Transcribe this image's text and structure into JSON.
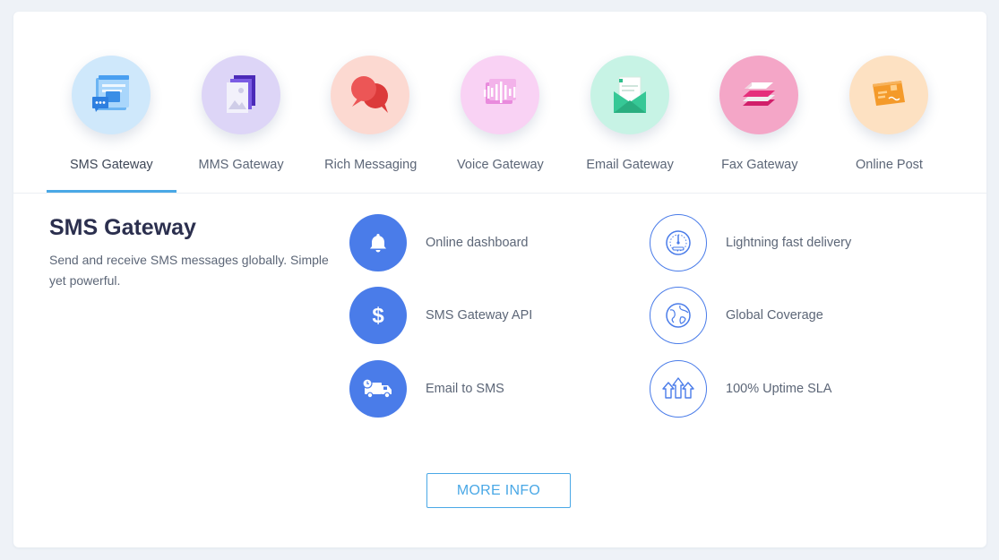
{
  "tabs": [
    {
      "label": "SMS Gateway",
      "icon": "sms-chat-window-icon",
      "color": "#cfe8fb",
      "active": true
    },
    {
      "label": "MMS Gateway",
      "icon": "mms-image-stack-icon",
      "color": "#ddd5f7",
      "active": false
    },
    {
      "label": "Rich Messaging",
      "icon": "chat-bubbles-icon",
      "color": "#fcd9d1",
      "active": false
    },
    {
      "label": "Voice Gateway",
      "icon": "voice-waveform-icon",
      "color": "#f9d2f4",
      "active": false
    },
    {
      "label": "Email Gateway",
      "icon": "email-envelope-icon",
      "color": "#c7f3e5",
      "active": false
    },
    {
      "label": "Fax Gateway",
      "icon": "fax-paper-stack-icon",
      "color": "#f4a6c7",
      "active": false
    },
    {
      "label": "Online Post",
      "icon": "postcard-icon",
      "color": "#fde1c2",
      "active": false
    }
  ],
  "panel": {
    "title": "SMS Gateway",
    "description": "Send and receive SMS messages globally. Simple yet powerful."
  },
  "features": [
    {
      "label": "Online dashboard",
      "icon": "bell-icon"
    },
    {
      "label": "SMS Gateway API",
      "icon": "dollar-icon"
    },
    {
      "label": "Email to SMS",
      "icon": "delivery-truck-icon"
    },
    {
      "label": "Lightning fast delivery",
      "icon": "speedometer-icon"
    },
    {
      "label": "Global Coverage",
      "icon": "globe-icon"
    },
    {
      "label": "100% Uptime SLA",
      "icon": "up-arrows-icon"
    }
  ],
  "more_button": {
    "label": "MORE INFO"
  },
  "colors": {
    "accent_blue": "#4aa8e6",
    "feature_blue": "#4a7ce9",
    "title_text": "#2b2f4e",
    "body_text": "#5c6677"
  }
}
